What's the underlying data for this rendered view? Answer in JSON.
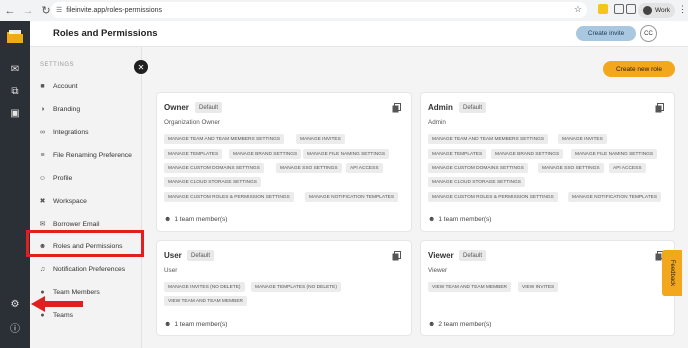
{
  "browser": {
    "url": "fileinvite.app/roles-permissions",
    "profile_label": "Work"
  },
  "header": {
    "title": "Roles and Permissions",
    "create_invite": "Create invite",
    "avatar_initials": "CC"
  },
  "sidebar": {
    "section_label": "SETTINGS",
    "items": [
      {
        "label": "Account",
        "icon": "account-icon"
      },
      {
        "label": "Branding",
        "icon": "palette-icon"
      },
      {
        "label": "Integrations",
        "icon": "link-icon"
      },
      {
        "label": "File Renaming Preference",
        "icon": "sliders-icon"
      },
      {
        "label": "Profile",
        "icon": "user-icon"
      },
      {
        "label": "Workspace",
        "icon": "tools-icon"
      },
      {
        "label": "Borrower Email",
        "icon": "mail-icon"
      },
      {
        "label": "Roles and Permissions",
        "icon": "users-icon"
      },
      {
        "label": "Notification Preferences",
        "icon": "bell-icon"
      },
      {
        "label": "Team Members",
        "icon": "team-icon"
      },
      {
        "label": "Teams",
        "icon": "teams-icon"
      }
    ]
  },
  "main": {
    "create_role": "Create new role",
    "cards": [
      {
        "title": "Owner",
        "badge": "Default",
        "subtitle": "Organization Owner",
        "tags": [
          "MANAGE TEAM AND TEAM MEMBERS SETTINGS",
          "MANAGE INVITES",
          "MANAGE TEMPLATES",
          "MANAGE BRAND SETTINGS",
          "MANAGE FILE NAMING SETTINGS",
          "MANAGE CUSTOM DOMAINS SETTINGS",
          "MANAGE SSO SETTINGS",
          "API ACCESS",
          "MANAGE CLOUD STORAGE SETTINGS",
          "MANAGE CUSTOM ROLES & PERMISSION SETTINGS",
          "MANAGE NOTIFICATION TEMPLATES"
        ],
        "members": "1 team member(s)"
      },
      {
        "title": "Admin",
        "badge": "Default",
        "subtitle": "Admin",
        "tags": [
          "MANAGE TEAM AND TEAM MEMBERS SETTINGS",
          "MANAGE INVITES",
          "MANAGE TEMPLATES",
          "MANAGE BRAND SETTINGS",
          "MANAGE FILE NAMING SETTINGS",
          "MANAGE CUSTOM DOMAINS SETTINGS",
          "MANAGE SSO SETTINGS",
          "API ACCESS",
          "MANAGE CLOUD STORAGE SETTINGS",
          "MANAGE CUSTOM ROLES & PERMISSION SETTINGS",
          "MANAGE NOTIFICATION TEMPLATES"
        ],
        "members": "1 team member(s)"
      },
      {
        "title": "User",
        "badge": "Default",
        "subtitle": "User",
        "tags": [
          "MANAGE INVITES (NO DELETE)",
          "MANAGE TEMPLATES (NO DELETE)",
          "VIEW TEAM AND TEAM MEMBER"
        ],
        "members": "1 team member(s)"
      },
      {
        "title": "Viewer",
        "badge": "Default",
        "subtitle": "Viewer",
        "tags": [
          "VIEW TEAM AND TEAM MEMBER",
          "VIEW INVITES"
        ],
        "members": "2 team member(s)"
      }
    ]
  },
  "feedback_label": "Feedback",
  "colors": {
    "accent_orange": "#f2a71d",
    "invite_blue": "#a9c7df",
    "rail_dark": "#2b2f36",
    "annotation_red": "#e02020"
  }
}
